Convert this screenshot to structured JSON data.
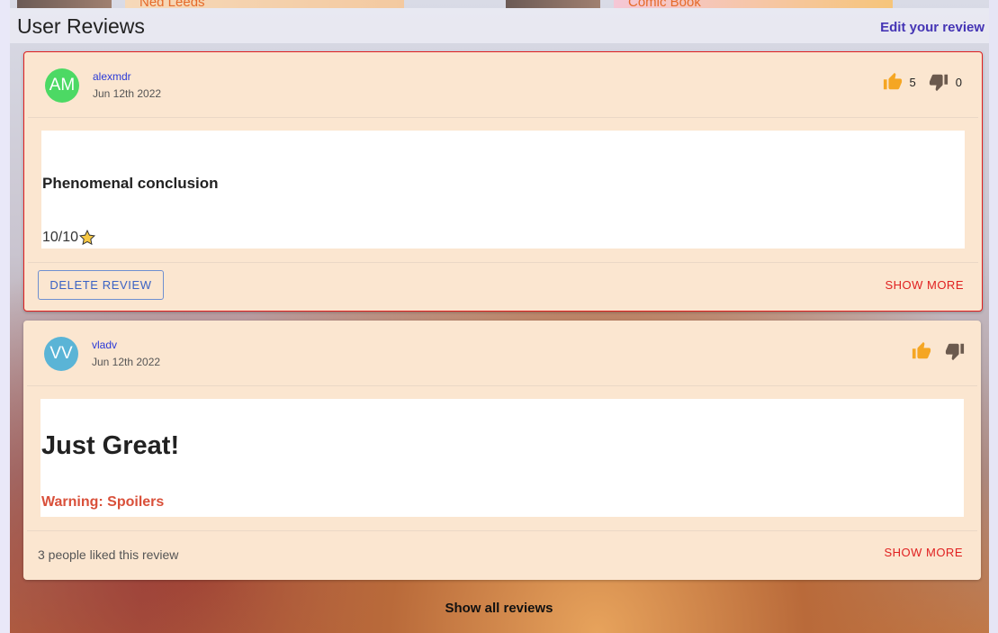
{
  "cast": [
    {
      "name": "Ned Leeds"
    },
    {
      "name": "Comic Book"
    }
  ],
  "section": {
    "title": "User Reviews",
    "edit_link": "Edit your review"
  },
  "reviews": [
    {
      "initials": "AM",
      "avatar_color": "#4cd964",
      "author": "alexmdr",
      "date": "Jun 12th 2022",
      "likes": "5",
      "dislikes": "0",
      "title": "Phenomenal conclusion",
      "rating": "10/10",
      "delete_label": "DELETE REVIEW",
      "show_more": "SHOW MORE"
    },
    {
      "initials": "VV",
      "avatar_color": "#5ab4d6",
      "author": "vladv",
      "date": "Jun 12th 2022",
      "title": "Just Great!",
      "spoiler": "Warning: Spoilers",
      "likes_text": "3 people liked this review",
      "show_more": "SHOW MORE"
    }
  ],
  "show_all": "Show all reviews",
  "colors": {
    "thumb_up": "#f5a623",
    "thumb_down": "#6b5a4e",
    "accent_red": "#e02020",
    "link_blue": "#2a3ad8"
  }
}
